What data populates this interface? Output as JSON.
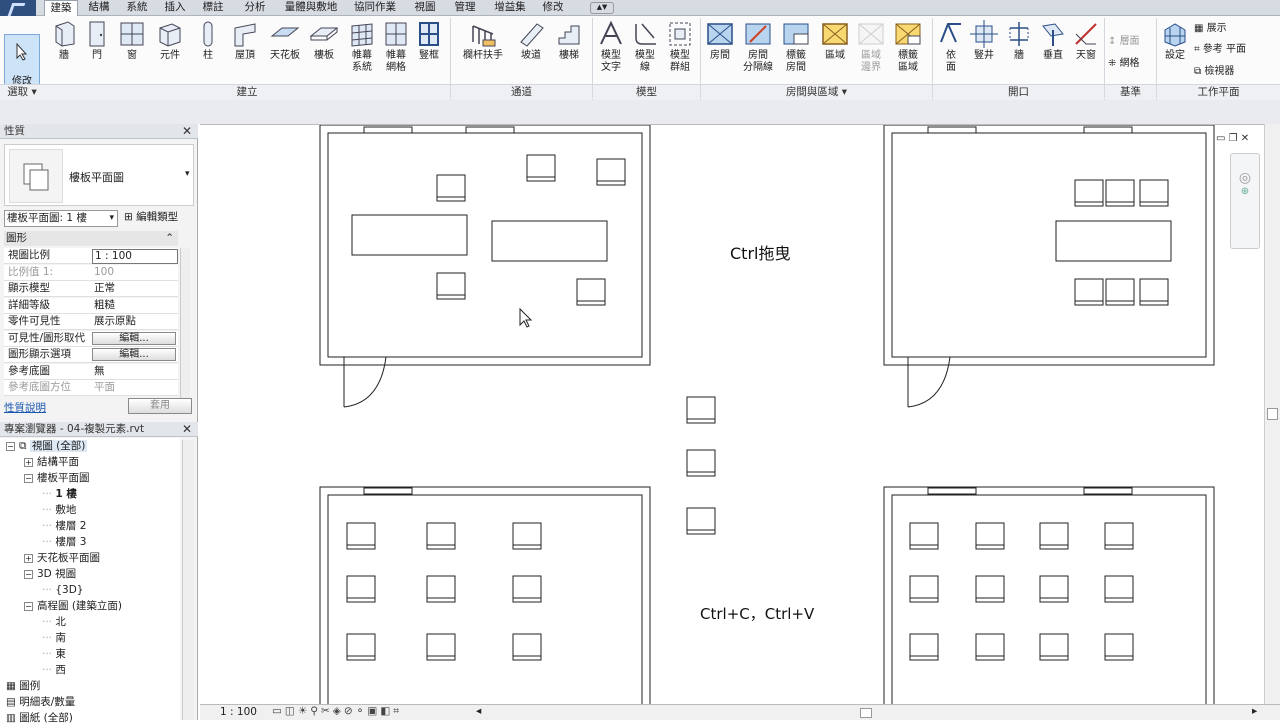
{
  "tabs": [
    "建築",
    "結構",
    "系統",
    "插入",
    "標註",
    "分析",
    "量體與敷地",
    "協同作業",
    "視圖",
    "管理",
    "增益集",
    "修改"
  ],
  "ribbon": {
    "modify_label": "修改",
    "select_label": "選取",
    "buttons": {
      "wall": "牆",
      "door": "門",
      "window": "窗",
      "component": "元件",
      "column": "柱",
      "roof": "屋頂",
      "ceiling": "天花板",
      "floor": "樓板",
      "curtain_system_1": "帷幕",
      "curtain_system_2": "系統",
      "curtain_grid_1": "帷幕",
      "curtain_grid_2": "網格",
      "mullion": "豎框",
      "railing": "欄杆扶手",
      "ramp": "坡道",
      "stair": "樓梯",
      "model_text_1": "模型",
      "model_text_2": "文字",
      "model_line_1": "模型",
      "model_line_2": "線",
      "model_group_1": "模型",
      "model_group_2": "群組",
      "room": "房間",
      "room_sep_1": "房間",
      "room_sep_2": "分隔線",
      "tag_room_1": "標籤",
      "tag_room_2": "房間",
      "area": "區域",
      "area_boundary_1": "區域",
      "area_boundary_2": "邊界",
      "tag_area_1": "標籤",
      "tag_area_2": "區域",
      "by_face_1": "依",
      "by_face_2": "面",
      "shaft": "豎井",
      "wall_opening": "牆",
      "vertical": "垂直",
      "dormer": "天窗",
      "level": "層面",
      "grid": "網格",
      "set": "設定",
      "show": "展示",
      "ref_plane": "參考 平面",
      "viewer": "檢視器"
    },
    "groups": {
      "build": "建立",
      "circulation": "通道",
      "model": "模型",
      "room_area": "房間與區域",
      "opening": "開口",
      "datum": "基準",
      "work_plane": "工作平面"
    }
  },
  "properties": {
    "header": "性質",
    "type_name": "樓板平面圖",
    "selector": "樓板平面圖: 1 樓",
    "edit_type": "編輯類型",
    "section": "圖形",
    "rows": [
      {
        "k": "視圖比例",
        "v": "1 : 100"
      },
      {
        "k": "比例值 1:",
        "v": "100"
      },
      {
        "k": "顯示模型",
        "v": "正常"
      },
      {
        "k": "詳細等級",
        "v": "粗糙"
      },
      {
        "k": "零件可見性",
        "v": "展示原點"
      },
      {
        "k": "可見性/圖形取代",
        "v": "編輯..."
      },
      {
        "k": "圖形顯示選項",
        "v": "編輯..."
      },
      {
        "k": "參考底圖",
        "v": "無"
      },
      {
        "k": "參考底圖方位",
        "v": "平面"
      }
    ],
    "help_link": "性質說明",
    "apply": "套用"
  },
  "browser": {
    "header": "專案瀏覽器 - 04-複製元素.rvt",
    "items": [
      {
        "label": "視圖 (全部)"
      },
      {
        "label": "結構平面"
      },
      {
        "label": "樓板平面圖"
      },
      {
        "label": "1 樓"
      },
      {
        "label": "敷地"
      },
      {
        "label": "樓層 2"
      },
      {
        "label": "樓層 3"
      },
      {
        "label": "天花板平面圖"
      },
      {
        "label": "3D 視圖"
      },
      {
        "label": "{3D}"
      },
      {
        "label": "高程圖 (建築立面)"
      },
      {
        "label": "北"
      },
      {
        "label": "南"
      },
      {
        "label": "東"
      },
      {
        "label": "西"
      },
      {
        "label": "圖例"
      },
      {
        "label": "明細表/數量"
      },
      {
        "label": "圖紙 (全部)"
      }
    ]
  },
  "canvas": {
    "annotation_drag": "Ctrl拖曳",
    "annotation_copy": "Ctrl+C，Ctrl+V"
  },
  "status": {
    "scale": "1 : 100"
  }
}
